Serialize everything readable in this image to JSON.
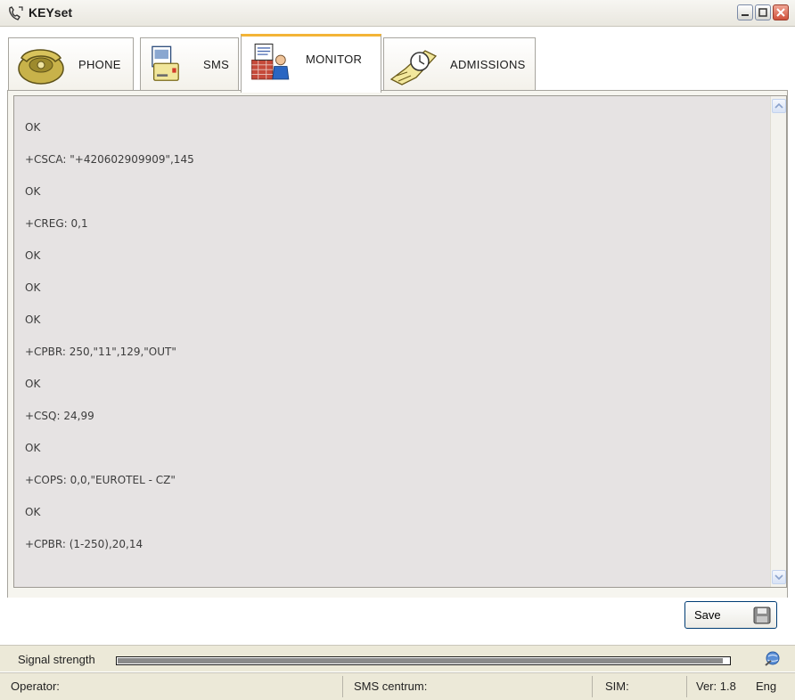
{
  "window": {
    "title": "KEYset"
  },
  "tabs": [
    {
      "label": "PHONE",
      "icon": "phone-icon"
    },
    {
      "label": "SMS",
      "icon": "sms-icon"
    },
    {
      "label": "MONITOR",
      "icon": "monitor-icon",
      "active": true
    },
    {
      "label": "ADMISSIONS",
      "icon": "admissions-icon"
    }
  ],
  "log": {
    "lines": [
      "OK",
      "+CSCA: \"+420602909909\",145",
      "OK",
      "+CREG: 0,1",
      "OK",
      "OK",
      "OK",
      "+CPBR: 250,\"11\",129,\"OUT\"",
      "OK",
      "+CSQ: 24,99",
      "OK",
      "+COPS: 0,0,\"EUROTEL - CZ\"",
      "OK",
      "+CPBR: (1-250),20,14"
    ]
  },
  "save_button": {
    "label": "Save"
  },
  "signal": {
    "label": "Signal strength",
    "level": 0.99
  },
  "status": {
    "operator_label": "Operator:",
    "sms_centrum_label": "SMS centrum:",
    "sim_label": "SIM:",
    "version": "Ver: 1.8",
    "language": "Eng"
  },
  "colors": {
    "active_tab_accent": "#f3b436",
    "log_background": "#e6e3e3",
    "chrome": "#ece9d8"
  }
}
